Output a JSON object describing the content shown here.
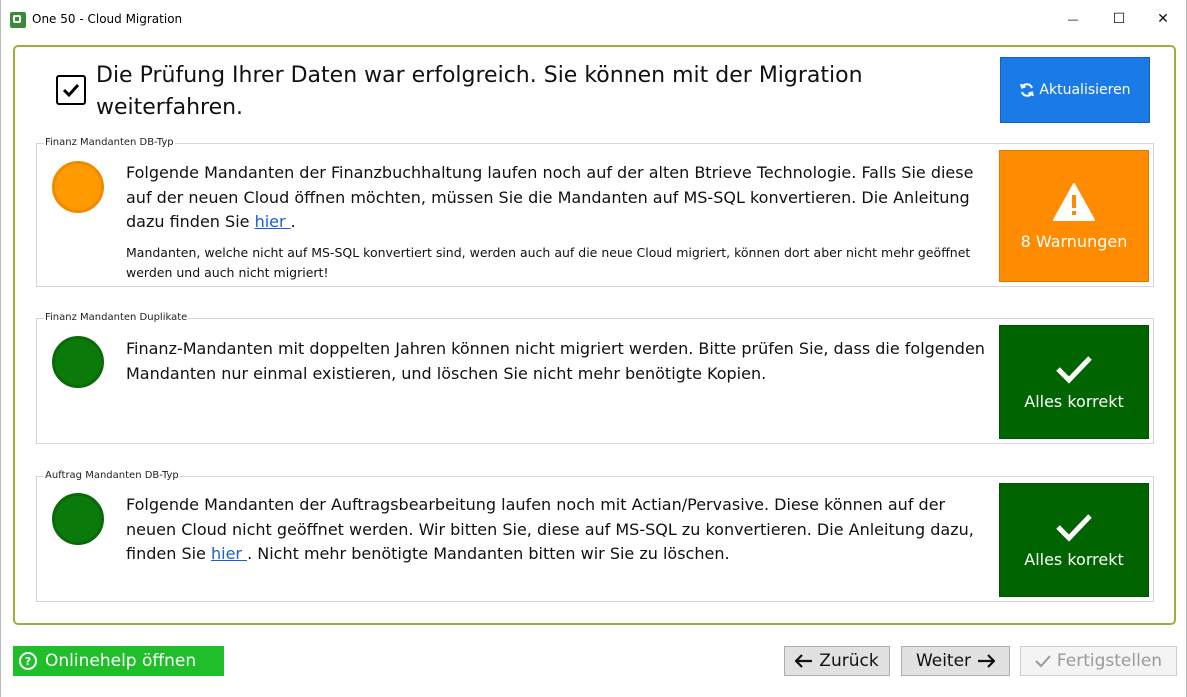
{
  "window": {
    "title": "One 50 - Cloud Migration",
    "minimize": "—",
    "maximize": "☐",
    "close": "✕"
  },
  "header": {
    "message": "Die Prüfung Ihrer Daten war erfolgreich. Sie können mit der Migration weiterfahren.",
    "refresh_label": "Aktualisieren"
  },
  "sections": [
    {
      "label": "Finanz Mandanten DB-Typ",
      "indicator": "orange",
      "text_before": "Folgende Mandanten der Finanzbuchhaltung laufen noch auf der alten Btrieve Technologie. Falls Sie diese auf der neuen Cloud öffnen möchten, müssen Sie die Mandanten auf MS-SQL konvertieren. Die Anleitung dazu finden Sie ",
      "link": " hier ",
      "text_after": ".",
      "subtext": "Mandanten, welche nicht auf MS-SQL konvertiert sind, werden auch auf die neue Cloud migriert, können dort aber nicht mehr geöffnet werden und auch nicht migriert!",
      "status_label": "8 Warnungen",
      "status_type": "warning"
    },
    {
      "label": "Finanz Mandanten Duplikate",
      "indicator": "green",
      "text": "Finanz-Mandanten mit doppelten Jahren können nicht migriert werden. Bitte prüfen Sie, dass die folgenden Mandanten nur einmal existieren, und löschen Sie nicht mehr benötigte Kopien.",
      "status_label": "Alles korrekt",
      "status_type": "ok"
    },
    {
      "label": "Auftrag Mandanten DB-Typ",
      "indicator": "green",
      "text_before": "Folgende Mandanten der Auftragsbearbeitung laufen noch mit Actian/Pervasive. Diese können auf der neuen Cloud nicht geöffnet werden. Wir bitten Sie, diese auf MS-SQL zu konvertieren. Die Anleitung dazu, finden Sie ",
      "link": " hier ",
      "text_after": ". Nicht mehr benötigte Mandanten bitten wir Sie zu löschen.",
      "status_label": "Alles korrekt",
      "status_type": "ok"
    }
  ],
  "footer": {
    "help_label": "Onlinehelp öffnen",
    "back_label": "Zurück",
    "next_label": "Weiter",
    "finish_label": "Fertigstellen"
  },
  "colors": {
    "warning": "#ff8c00",
    "ok": "#006400",
    "accent_blue": "#1a7be6",
    "help_green": "#1fbf2a",
    "frame": "#9bb23a"
  }
}
